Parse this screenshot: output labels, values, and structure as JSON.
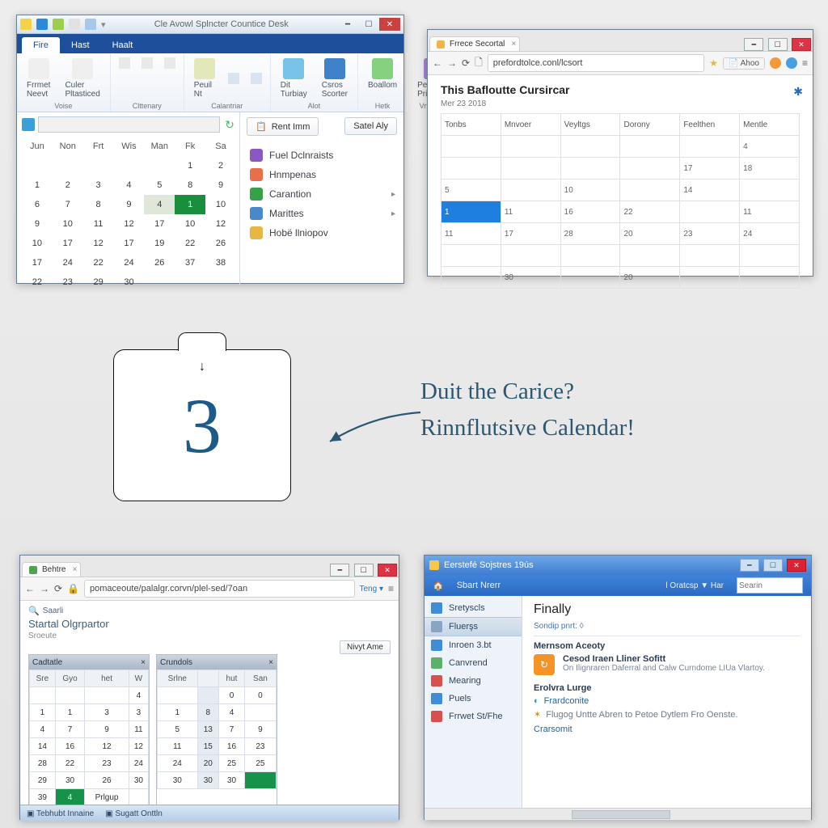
{
  "win1": {
    "qat_icons": [
      "#f5d24a",
      "#2b8bd6",
      "#9ccf4d",
      "#e2e2e2",
      "#a6c9ea"
    ],
    "title": "Cle Avowl Splncter Countice Desk",
    "tabs": [
      {
        "label": "Fire",
        "active": true
      },
      {
        "label": "Hast",
        "active": false
      },
      {
        "label": "Haalt",
        "active": false
      }
    ],
    "ribbon_groups": [
      {
        "label": "Voise",
        "big": [
          {
            "label": "Frrmet\nNeevt",
            "color": "#efefef"
          },
          {
            "label": "Culer\nPltasticed",
            "color": "#efefef"
          }
        ]
      },
      {
        "label": "Clttenary",
        "big": [],
        "small": [
          {
            "label": "",
            "color": "#e9e9e9"
          },
          {
            "label": "",
            "color": "#e9e9e9"
          },
          {
            "label": "",
            "color": "#e9e9e9"
          }
        ]
      },
      {
        "label": "Calantriar",
        "big": [
          {
            "label": "Peuil\nNt",
            "color": "#e2e8b7"
          }
        ],
        "small": [
          {
            "label": "",
            "color": "#d9e3f2"
          },
          {
            "label": "",
            "color": "#d9e3f2"
          }
        ]
      },
      {
        "label": "Alot",
        "big": [
          {
            "label": "Dit\nTurbiay",
            "color": "#79c2e8"
          },
          {
            "label": "Csros\nScorter",
            "color": "#3e82c9"
          }
        ]
      },
      {
        "label": "Hetk",
        "big": [
          {
            "label": "Boallom",
            "color": "#84d27f"
          }
        ]
      },
      {
        "label": "Vrthentte",
        "big": [
          {
            "label": "Perponar\nPrintois",
            "color": "#a782d8"
          }
        ]
      }
    ],
    "search_value": "",
    "dow": [
      "Jun",
      "Non",
      "Frt",
      "Wis",
      "Man",
      "Fk",
      "Sa"
    ],
    "weeks": [
      [
        "",
        "",
        "",
        "",
        "",
        "1",
        "2"
      ],
      [
        "1",
        "2",
        "3",
        "4",
        "5",
        "8",
        "9"
      ],
      [
        "6",
        "7",
        "8",
        "9",
        "4",
        "1",
        "10"
      ],
      [
        "9",
        "10",
        "11",
        "12",
        "17",
        "10",
        "12"
      ],
      [
        "10",
        "17",
        "12",
        "17",
        "19",
        "22",
        "26"
      ],
      [
        "17",
        "24",
        "22",
        "24",
        "26",
        "37",
        "38"
      ],
      [
        "22",
        "23",
        "29",
        "30",
        "",
        "",
        ""
      ]
    ],
    "today_cell": [
      2,
      5
    ],
    "sel_cell": [
      2,
      4
    ],
    "side_btn_left": "Rent Imm",
    "side_btn_right": "Satel Aly",
    "side_links": [
      {
        "label": "Fuel Dclnraists",
        "color": "#8b57c2",
        "chev": false
      },
      {
        "label": "Hnmpenas",
        "color": "#e86f4a",
        "chev": false
      },
      {
        "label": "Carantion",
        "color": "#35a24a",
        "chev": true
      },
      {
        "label": "Marittes",
        "color": "#4a88cc",
        "chev": true
      },
      {
        "label": "Hobë llniopov",
        "color": "#e8b642",
        "chev": false
      }
    ]
  },
  "win2": {
    "tab_title": "Frrece Secortal",
    "url": "prefordtolce.conl/lcsort",
    "url_right_chip": "Ahoo",
    "page_title": "This Bafloutte Cursircar",
    "page_sub": "Mer 23 2018",
    "dow": [
      "Tonbs",
      "Mnvoer",
      "Veyltgs",
      "Dorony",
      "Feelthen",
      "Mentle"
    ],
    "rows": [
      [
        "",
        "",
        "",
        "",
        "",
        "4"
      ],
      [
        "",
        "",
        "",
        "",
        "17",
        "18"
      ],
      [
        "5",
        "",
        "10",
        "",
        "14",
        ""
      ],
      [
        "1",
        "11",
        "16",
        "22",
        "",
        "11"
      ],
      [
        "11",
        "17",
        "28",
        "20",
        "23",
        "24"
      ],
      [
        "",
        "",
        "",
        "",
        "",
        ""
      ],
      [
        "",
        "30",
        "",
        "20",
        "",
        ""
      ]
    ],
    "sel_cell": [
      3,
      0
    ]
  },
  "center": {
    "number": "3",
    "line1": "Duit the Carice?",
    "line2": "Rinnflutsive Calendar!"
  },
  "win3": {
    "tab_title": "Behtre",
    "url": "pomaceoute/palalgr.corvn/plel-sed/7oan",
    "url_right": "Teng ▾",
    "header": "Startal Olgrpartor",
    "sub": "Sroeute",
    "new_btn": "Nivyt Ame",
    "panels": [
      {
        "title": "Cadtatle",
        "dow": [
          "Sre",
          "Gyo",
          "het",
          "W"
        ],
        "rows": [
          [
            "",
            "",
            "",
            "4"
          ],
          [
            "1",
            "1",
            "3",
            "3"
          ],
          [
            "4",
            "7",
            "9",
            "11"
          ],
          [
            "14",
            "16",
            "12",
            "12"
          ],
          [
            "28",
            "22",
            "23",
            "24"
          ],
          [
            "29",
            "30",
            "26",
            "30"
          ],
          [
            "39",
            "4",
            "Prlgup",
            ""
          ]
        ],
        "sel": [
          6,
          1
        ]
      },
      {
        "title": "Crundols",
        "dow": [
          "Srlne",
          "",
          "hut",
          "San"
        ],
        "rows": [
          [
            "",
            "",
            "0",
            "0"
          ],
          [
            "1",
            "8",
            "4",
            ""
          ],
          [
            "5",
            "13",
            "7",
            "9"
          ],
          [
            "11",
            "15",
            "16",
            "23"
          ],
          [
            "24",
            "20",
            "25",
            "25"
          ],
          [
            "30",
            "30",
            "30",
            ""
          ]
        ],
        "sel": [
          5,
          3
        ],
        "shade_col": 1
      }
    ],
    "status_items": [
      "Tebhubt Innaine",
      "Sugatt Onttln"
    ],
    "side_icon_label": "Saarli"
  },
  "win4": {
    "title_text": "Eerstefé Sojstres 19ús",
    "title_right": "l Oratcsp ▼  Har",
    "toolbar_left": "Sbart Nrerr",
    "search_ph": "Searin",
    "side_items": [
      {
        "label": "Sretyscls",
        "color": "#3e8dd6",
        "sel": false
      },
      {
        "label": "Fluerşs",
        "color": "#8aa5c2",
        "sel": true
      },
      {
        "label": "Inroen 3.bt",
        "color": "#3e8dd6",
        "sel": false
      },
      {
        "label": "Canvrend",
        "color": "#5bb06a",
        "sel": false
      },
      {
        "label": "Mearing",
        "color": "#d94f4f",
        "sel": false
      },
      {
        "label": "Puels",
        "color": "#3e8dd6",
        "sel": false
      },
      {
        "label": "Frrwet St/Fhe",
        "color": "#d94f4f",
        "sel": false
      }
    ],
    "heading": "Finally",
    "sub": "Sondip pnrt: ◊",
    "sect_title": "Mernsom Aceoty",
    "card_title": "Cesod Iraen Lliner Sofitt",
    "card_desc": "On Ilignraren Daferral and Calw Curndome LIUa Vlartoy.",
    "h5": "Erolvra Lurge",
    "link1": "Frardconite",
    "link2": "Flugog Untte Abren to Petoe Dytlem Fro Oenste.",
    "link3": "Crarsomit"
  }
}
